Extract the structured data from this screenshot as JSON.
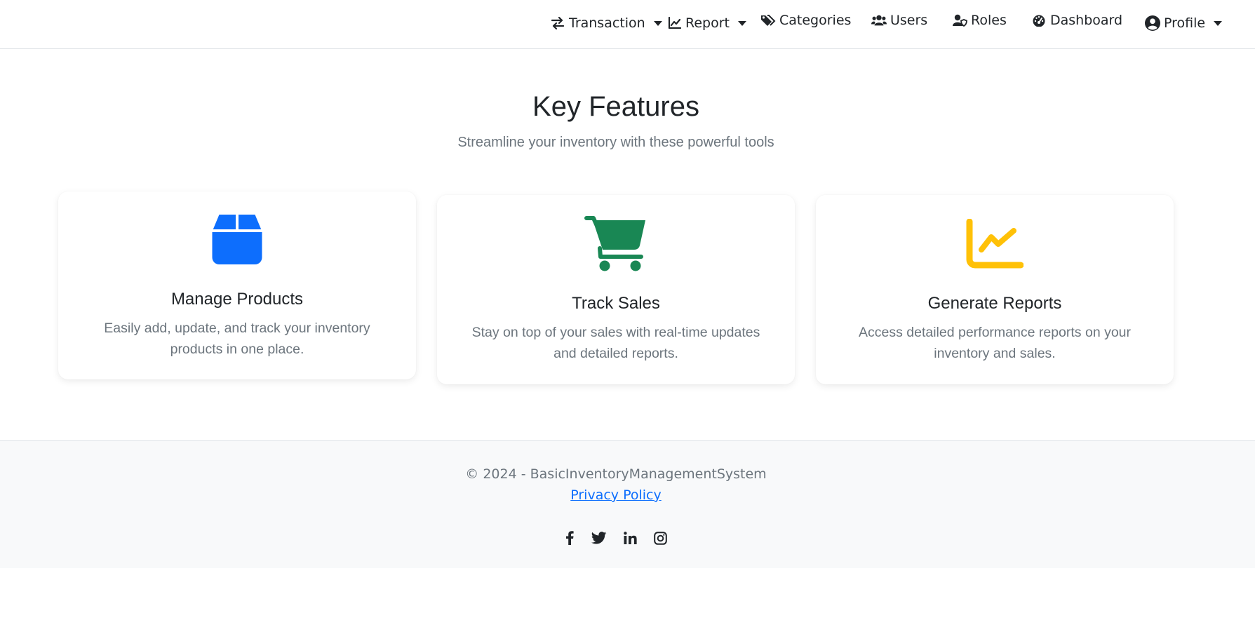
{
  "nav": {
    "transaction": "Transaction",
    "report": "Report",
    "categories": "Categories",
    "users": "Users",
    "roles": "Roles",
    "dashboard": "Dashboard",
    "profile": "Profile"
  },
  "hero": {
    "title": "Key Features",
    "subtitle": "Streamline your inventory with these powerful tools"
  },
  "features": [
    {
      "title": "Manage Products",
      "text": "Easily add, update, and track your inventory products in one place.",
      "icon": "box-icon",
      "color": "#0d6efd"
    },
    {
      "title": "Track Sales",
      "text": "Stay on top of your sales with real-time updates and detailed reports.",
      "icon": "cart-icon",
      "color": "#198754"
    },
    {
      "title": "Generate Reports",
      "text": "Access detailed performance reports on your inventory and sales.",
      "icon": "chart-line-icon",
      "color": "#ffc107"
    }
  ],
  "footer": {
    "copyright": "© 2024 - BasicInventoryManagementSystem",
    "privacy": "Privacy Policy"
  },
  "colors": {
    "primary": "#0d6efd",
    "success": "#198754",
    "warning": "#ffc107",
    "muted": "#6c757d",
    "footer_bg": "#f8f9fa"
  }
}
